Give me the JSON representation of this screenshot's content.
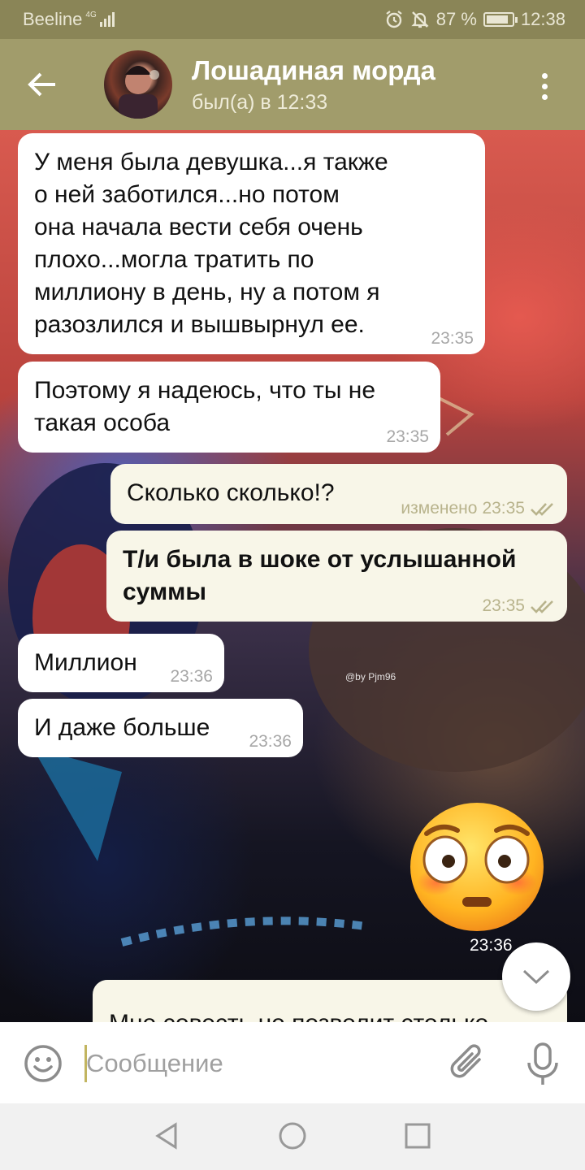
{
  "status_bar": {
    "carrier": "Beeline",
    "network": "4G",
    "battery": "87 %",
    "battery_level": 0.87,
    "time": "12:38",
    "icons": [
      "signal-icon",
      "alarm-icon",
      "mute-icon",
      "battery-icon"
    ]
  },
  "header": {
    "chat_title": "Лошадиная морда",
    "status": "был(а) в 12:33",
    "icons": [
      "back-arrow-icon",
      "avatar",
      "more-vert-icon"
    ]
  },
  "messages": [
    {
      "direction": "in",
      "text": "У меня была девушка...я также\nо ней заботился...но потом\nона начала вести себя очень\nплохо...могла тратить по\nмиллиону в день, ну а потом я\nразозлился и вышвырнул ее.",
      "time": "23:35"
    },
    {
      "direction": "in",
      "text": "Поэтому я надеюсь, что ты не\nтакая особа",
      "time": "23:35"
    },
    {
      "direction": "out",
      "text": "Сколько сколько!?",
      "edited": "изменено",
      "time": "23:35",
      "read": true
    },
    {
      "direction": "out",
      "text": "Т/и была в шоке от услышанной\nсуммы",
      "time": "23:35",
      "read": true
    },
    {
      "direction": "in",
      "text": "Миллион",
      "time": "23:36"
    },
    {
      "direction": "in",
      "text": "И даже больше",
      "time": "23:36"
    },
    {
      "direction": "out",
      "type": "sticker",
      "sticker": "flushed-face-emoji",
      "time": "23:36"
    },
    {
      "direction": "out",
      "text": "Мне совесть не позволит столько",
      "partial": true
    }
  ],
  "wallpaper": {
    "watermark": "@by Pjm96"
  },
  "input": {
    "placeholder": "Сообщение",
    "value": "",
    "icons": [
      "emoji-icon",
      "attach-icon",
      "mic-icon"
    ]
  },
  "colors": {
    "status_bar": "#8a8557",
    "header": "#a19c6b",
    "incoming_bubble": "#ffffff",
    "outgoing_bubble": "#f8f6e8",
    "check_marks": "#b8b38c",
    "cursor": "#c2b560"
  },
  "nav_bar": {
    "icons": [
      "nav-back-icon",
      "nav-home-icon",
      "nav-recent-icon"
    ]
  }
}
